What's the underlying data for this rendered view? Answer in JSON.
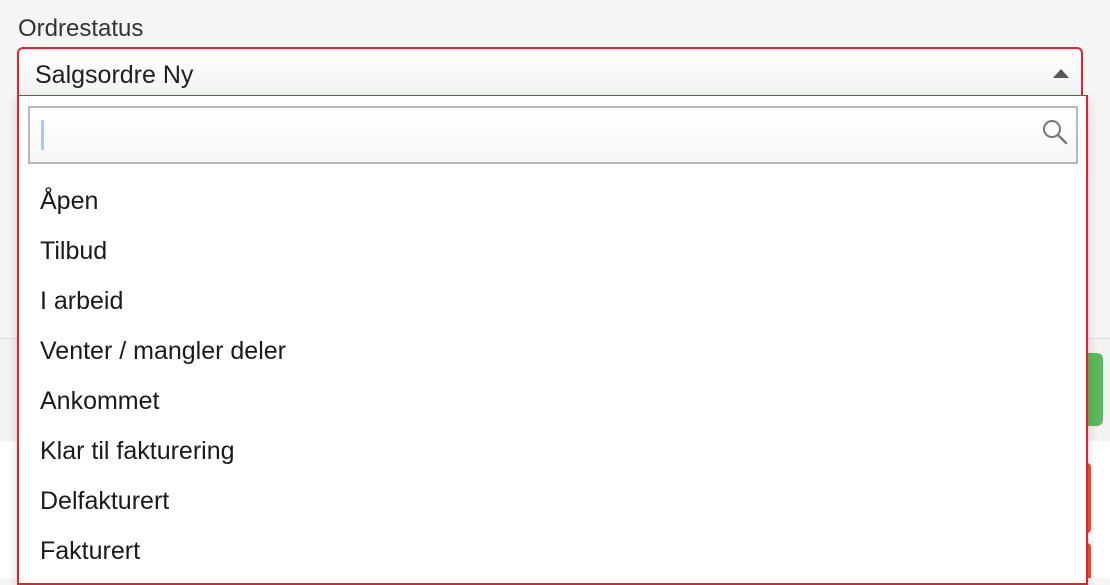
{
  "field": {
    "label": "Ordrestatus",
    "selected_value": "Salgsordre Ny"
  },
  "search": {
    "value": "",
    "placeholder": ""
  },
  "options": [
    "Åpen",
    "Tilbud",
    "I arbeid",
    "Venter / mangler deler",
    "Ankommet",
    "Klar til fakturering",
    "Delfakturert",
    "Fakturert"
  ],
  "colors": {
    "accent_border": "#e8202e",
    "green_button": "#5cb85c",
    "orange_button": "#e8542e"
  },
  "icons": {
    "dropdown_caret": "caret-up-icon",
    "search": "search-icon"
  }
}
